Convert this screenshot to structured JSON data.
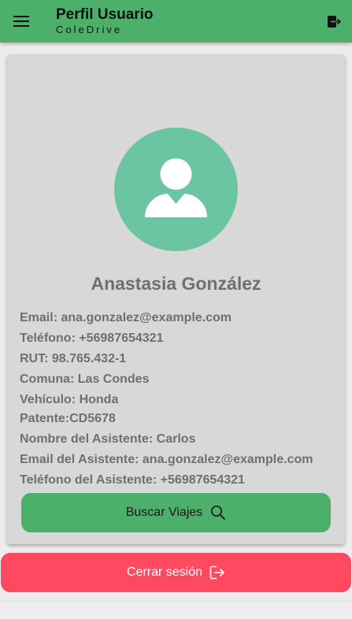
{
  "header": {
    "title": "Perfil Usuario",
    "subtitle": "ColeDrive",
    "menu_icon": "menu-icon",
    "exit_icon": "exit-icon"
  },
  "profile": {
    "avatar_icon": "person-icon",
    "name": "Anastasia González",
    "fields": [
      "Email: ana.gonzalez@example.com",
      "Teléfono: +56987654321",
      "RUT: 98.765.432-1",
      "Comuna: Las Condes",
      "Vehículo: Honda",
      "Patente:CD5678",
      "Nombre del Asistente: Carlos",
      "Email del Asistente: ana.gonzalez@example.com",
      "Teléfono del Asistente: +56987654321"
    ]
  },
  "actions": {
    "search_label": "Buscar Viajes",
    "search_icon": "search-icon",
    "logout_label": "Cerrar sesión",
    "logout_icon": "logout-icon"
  },
  "colors": {
    "primary": "#4caf6a",
    "avatar": "#6cc5a2",
    "danger": "#ff4961",
    "card": "#d8d8d8",
    "text_muted": "#6f6f6f"
  }
}
